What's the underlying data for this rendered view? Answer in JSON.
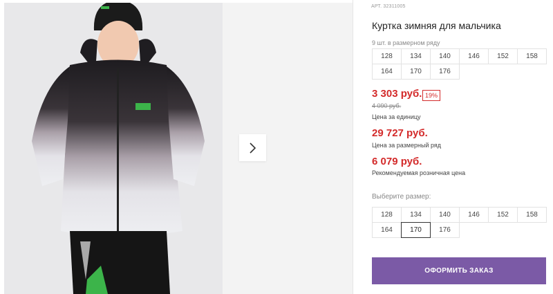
{
  "product": {
    "article": "АРТ. 32311005",
    "title": "Куртка зимняя для мальчика",
    "pack_info": "9 шт. в размерном ряду",
    "size_row": [
      "128",
      "134",
      "140",
      "146",
      "152",
      "158",
      "164",
      "170",
      "176"
    ]
  },
  "prices": {
    "unit_price": "3 303 руб.",
    "discount": "19%",
    "old_price": "4 090 руб.",
    "unit_label": "Цена за единицу",
    "row_price": "29 727 руб.",
    "row_label": "Цена за размерный ряд",
    "rrp_price": "6 079 руб.",
    "rrp_label": "Рекомендуемая розничная цена"
  },
  "size_picker": {
    "label": "Выберите размер:",
    "sizes": [
      "128",
      "134",
      "140",
      "146",
      "152",
      "158",
      "164",
      "170",
      "176"
    ],
    "selected": "170"
  },
  "actions": {
    "order_label": "ОФОРМИТЬ ЗАКАЗ"
  },
  "gallery": {
    "next_icon": "chevron-right-icon",
    "photo_description_icon": "product-photo"
  },
  "colors": {
    "price": "#d32a2a",
    "accent_button": "#7b5aa6"
  }
}
